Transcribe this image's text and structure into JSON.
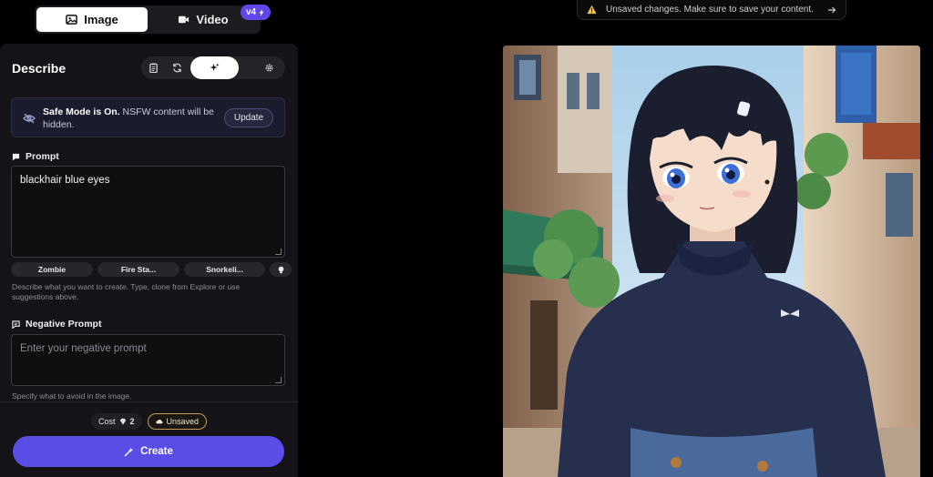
{
  "mode_toggle": {
    "image_label": "Image",
    "video_label": "Video",
    "version_badge": "v4"
  },
  "panel": {
    "title": "Describe",
    "safe_mode": {
      "bold": "Safe Mode is On.",
      "text": " NSFW content will be hidden.",
      "button": "Update"
    },
    "prompt": {
      "label": "Prompt",
      "value": "blackhair blue eyes",
      "suggestions": [
        "Zombie",
        "Fire Sta...",
        "Snorkeli..."
      ],
      "hint": "Describe what you want to create. Type, clone from Explore or use suggestions above."
    },
    "negative_prompt": {
      "label": "Negative Prompt",
      "placeholder": "Enter your negative prompt",
      "hint": "Specify what to avoid in the image."
    },
    "cost": {
      "label": "Cost",
      "value": "2"
    },
    "status": "Unsaved",
    "create_button": "Create"
  },
  "notice": {
    "text": "Unsaved changes. Make sure to save your content."
  },
  "image": {
    "description": "anime girl with black bob hair and blue eyes in a street",
    "colors": {
      "sky": "#bcd9ee",
      "hair": "#1a1e2e",
      "shirt": "#26304e",
      "skin": "#f6dccb",
      "eyes": "#3e6fd6"
    }
  },
  "colors": {
    "accent": "#5a4de6",
    "badge": "#6047e8",
    "unsaved_border": "#c69a52"
  }
}
